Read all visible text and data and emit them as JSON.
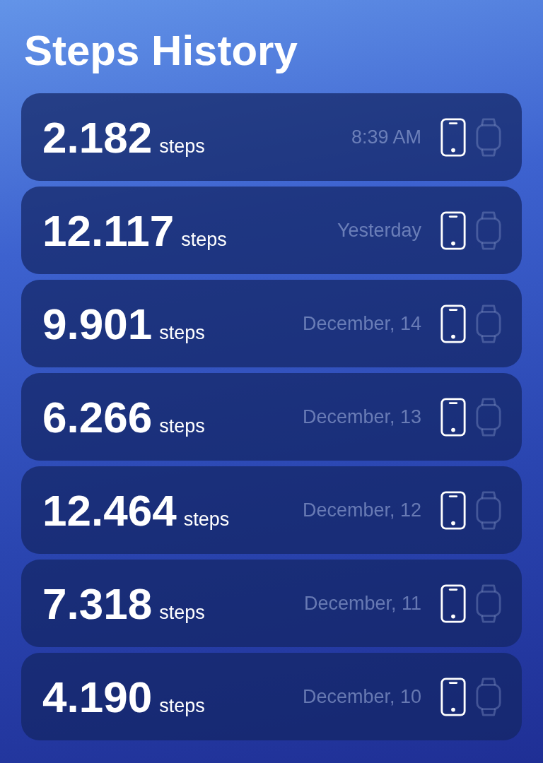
{
  "title": "Steps History",
  "rows": [
    {
      "count": "2.182",
      "unit": "steps",
      "time": "8:39 AM",
      "phone": true,
      "watch": false
    },
    {
      "count": "12.117",
      "unit": "steps",
      "time": "Yesterday",
      "phone": true,
      "watch": false
    },
    {
      "count": "9.901",
      "unit": "steps",
      "time": "December, 14",
      "phone": true,
      "watch": false
    },
    {
      "count": "6.266",
      "unit": "steps",
      "time": "December, 13",
      "phone": true,
      "watch": false
    },
    {
      "count": "12.464",
      "unit": "steps",
      "time": "December, 12",
      "phone": true,
      "watch": false
    },
    {
      "count": "7.318",
      "unit": "steps",
      "time": "December, 11",
      "phone": true,
      "watch": false
    },
    {
      "count": "4.190",
      "unit": "steps",
      "time": "December, 10",
      "phone": true,
      "watch": false
    }
  ]
}
